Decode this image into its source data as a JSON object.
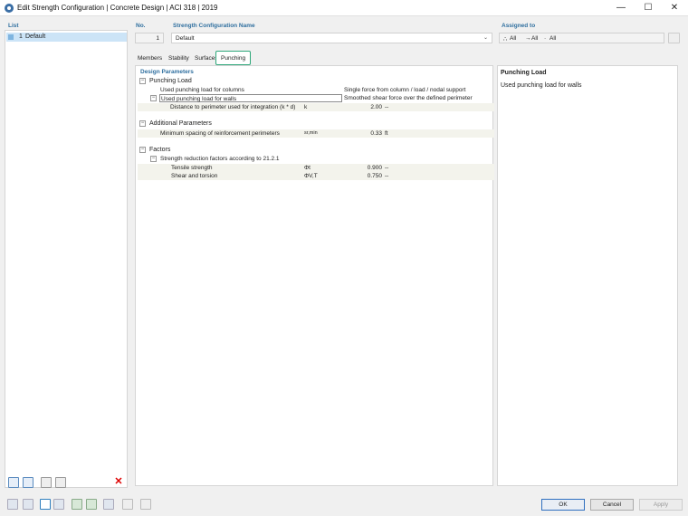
{
  "window": {
    "title": "Edit Strength Configuration | Concrete Design | ACI 318 | 2019",
    "min": "—",
    "max": "☐",
    "close": "✕"
  },
  "list": {
    "header": "List",
    "items": [
      {
        "number": "1",
        "label": "Default"
      }
    ]
  },
  "number": {
    "header": "No.",
    "value": "1"
  },
  "config_name": {
    "header": "Strength Configuration Name",
    "value": "Default"
  },
  "assigned": {
    "header": "Assigned to",
    "items": [
      "All",
      "All",
      "All"
    ]
  },
  "tabs": [
    "Members",
    "Stability",
    "Surfaces",
    "Punching"
  ],
  "design": {
    "header": "Design Parameters",
    "groups": {
      "punching_load": {
        "label": "Punching Load",
        "rows": [
          {
            "label": "Used punching load for columns",
            "value": "Single force from column / load / nodal support"
          },
          {
            "label": "Used punching load for walls",
            "value": "Smoothed shear force over the defined perimeter"
          },
          {
            "label": "Distance to perimeter used for integration (k * d)",
            "symbol": "k",
            "value": "2.00",
            "unit": "--"
          }
        ]
      },
      "additional": {
        "label": "Additional Parameters",
        "rows": [
          {
            "label": "Minimum spacing of reinforcement perimeters",
            "symbol": "sr,min",
            "value": "0.33",
            "unit": "ft"
          }
        ]
      },
      "factors": {
        "label": "Factors",
        "sub": "Strength reduction factors according to 21.2.1",
        "rows": [
          {
            "label": "Tensile strength",
            "symbol": "Φt",
            "value": "0.900",
            "unit": "--"
          },
          {
            "label": "Shear and torsion",
            "symbol": "ΦV,T",
            "value": "0.750",
            "unit": "--"
          }
        ]
      }
    }
  },
  "info": {
    "header": "Punching Load",
    "text": "Used punching load for walls"
  },
  "buttons": {
    "ok": "OK",
    "cancel": "Cancel",
    "apply": "Apply"
  },
  "colors": {
    "accent": "#2f6f9f",
    "tab_highlight": "#2ea77a",
    "selection": "#cce4f7"
  }
}
